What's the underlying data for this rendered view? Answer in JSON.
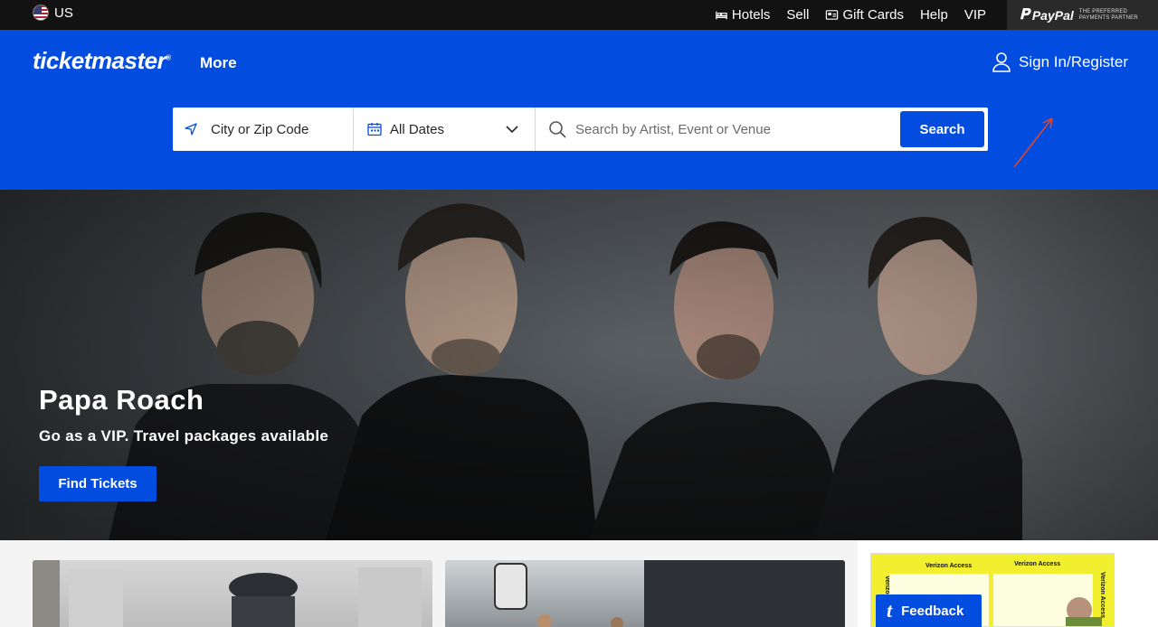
{
  "topbar": {
    "region": "US",
    "links": [
      {
        "label": "Hotels",
        "icon": "bed-icon"
      },
      {
        "label": "Sell"
      },
      {
        "label": "Gift Cards",
        "icon": "gift-card-icon"
      },
      {
        "label": "Help"
      },
      {
        "label": "VIP"
      }
    ],
    "paypal": {
      "brand": "PayPal",
      "tagline": "THE PREFERRED PAYMENTS PARTNER"
    }
  },
  "header": {
    "logo": "ticketmaster",
    "more_label": "More",
    "signin_label": "Sign In/Register",
    "accent": "#024ddf"
  },
  "search": {
    "location_placeholder": "City or Zip Code",
    "date_value": "All Dates",
    "query_placeholder": "Search by Artist, Event or Venue",
    "button_label": "Search"
  },
  "hero": {
    "title": "Papa Roach",
    "subtitle": "Go as a VIP. Travel packages available",
    "cta_label": "Find Tickets"
  },
  "ad": {
    "labels": [
      "Verizon Access",
      "Verizon Access",
      "Verizon Access",
      "Verizon Access"
    ]
  },
  "feedback": {
    "label": "Feedback",
    "icon_glyph": "t"
  }
}
